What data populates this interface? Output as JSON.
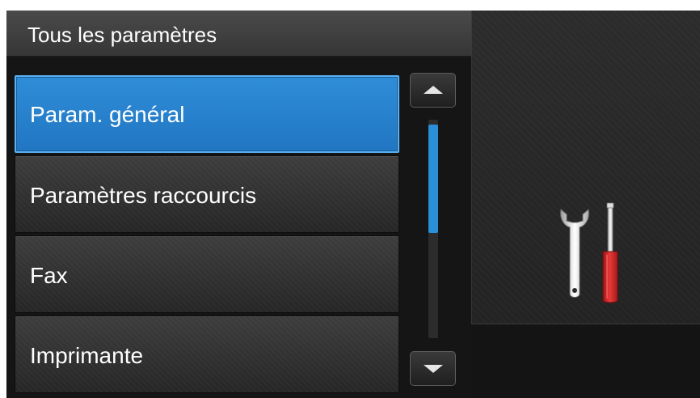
{
  "header": {
    "title": "Tous les paramètres"
  },
  "menu": {
    "items": [
      {
        "label": "Param. général",
        "selected": true
      },
      {
        "label": "Paramètres raccourcis",
        "selected": false
      },
      {
        "label": "Fax",
        "selected": false
      },
      {
        "label": "Imprimante",
        "selected": false
      }
    ]
  },
  "scrollbar": {
    "position_fraction": 0.0,
    "visible_fraction": 0.52
  },
  "icons": {
    "scroll_up": "triangle-up",
    "scroll_down": "triangle-down",
    "settings": "wrench-and-screwdriver"
  },
  "colors": {
    "selected": "#2a85d0",
    "scroll_thumb": "#2a8ed8",
    "screwdriver_handle": "#d42a2a",
    "background": "#111111"
  }
}
